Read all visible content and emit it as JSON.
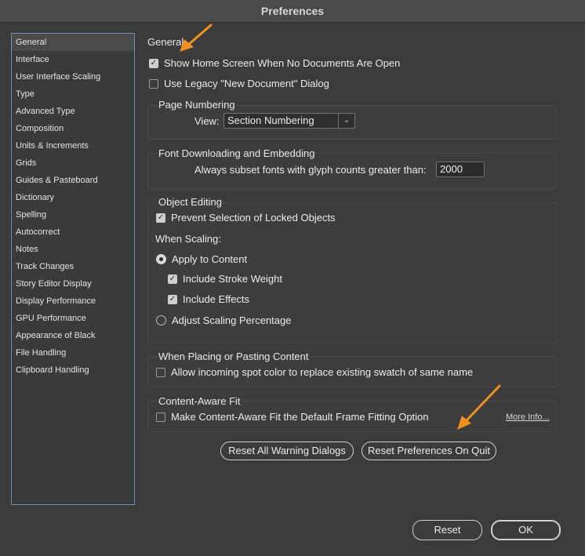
{
  "window": {
    "title": "Preferences"
  },
  "sidebar": {
    "items": [
      {
        "label": "General",
        "selected": true
      },
      {
        "label": "Interface"
      },
      {
        "label": "User Interface Scaling"
      },
      {
        "label": "Type"
      },
      {
        "label": "Advanced Type"
      },
      {
        "label": "Composition"
      },
      {
        "label": "Units & Increments"
      },
      {
        "label": "Grids"
      },
      {
        "label": "Guides & Pasteboard"
      },
      {
        "label": "Dictionary"
      },
      {
        "label": "Spelling"
      },
      {
        "label": "Autocorrect"
      },
      {
        "label": "Notes"
      },
      {
        "label": "Track Changes"
      },
      {
        "label": "Story Editor Display"
      },
      {
        "label": "Display Performance"
      },
      {
        "label": "GPU Performance"
      },
      {
        "label": "Appearance of Black"
      },
      {
        "label": "File Handling"
      },
      {
        "label": "Clipboard Handling"
      }
    ]
  },
  "general": {
    "title": "General",
    "show_home_screen": {
      "label": "Show Home Screen When No Documents Are Open",
      "checked": true
    },
    "legacy_new_doc": {
      "label": "Use Legacy \"New Document\" Dialog",
      "checked": false
    },
    "page_numbering": {
      "title": "Page Numbering",
      "view_label": "View:",
      "view_value": "Section Numbering"
    },
    "font_downloading": {
      "title": "Font Downloading and Embedding",
      "subset_label": "Always subset fonts with glyph counts greater than:",
      "subset_value": "2000"
    },
    "object_editing": {
      "title": "Object Editing",
      "prevent_selection": {
        "label": "Prevent Selection of Locked Objects",
        "checked": true
      },
      "when_scaling": "When Scaling:",
      "apply_to_content": {
        "label": "Apply to Content",
        "selected": true
      },
      "include_stroke": {
        "label": "Include Stroke Weight",
        "checked": true
      },
      "include_effects": {
        "label": "Include Effects",
        "checked": true
      },
      "adjust_scaling": {
        "label": "Adjust Scaling Percentage",
        "selected": false
      }
    },
    "placing": {
      "title": "When Placing or Pasting Content",
      "allow_spot": {
        "label": "Allow incoming spot color to replace existing swatch of same name",
        "checked": false
      }
    },
    "content_aware": {
      "title": "Content-Aware Fit",
      "make_default": {
        "label": "Make Content-Aware Fit the Default Frame Fitting Option",
        "checked": false
      },
      "more_info": "More Info..."
    },
    "buttons": {
      "reset_warnings": "Reset All Warning Dialogs",
      "reset_prefs": "Reset Preferences On Quit"
    }
  },
  "footer": {
    "reset": "Reset",
    "ok": "OK"
  },
  "colors": {
    "accent_arrow": "#f0901e",
    "sidebar_border": "#6f8fb3"
  }
}
